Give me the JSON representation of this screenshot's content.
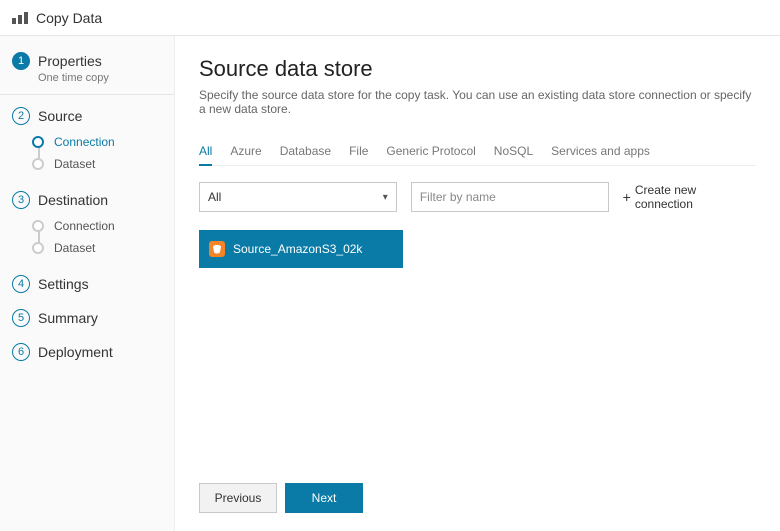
{
  "header": {
    "title": "Copy Data"
  },
  "sidebar": {
    "steps": [
      {
        "label": "Properties",
        "sub": "One time copy"
      },
      {
        "label": "Source"
      },
      {
        "label": "Destination"
      },
      {
        "label": "Settings"
      },
      {
        "label": "Summary"
      },
      {
        "label": "Deployment"
      }
    ],
    "source_substeps": [
      {
        "label": "Connection"
      },
      {
        "label": "Dataset"
      }
    ],
    "dest_substeps": [
      {
        "label": "Connection"
      },
      {
        "label": "Dataset"
      }
    ]
  },
  "main": {
    "title": "Source data store",
    "description": "Specify the source data store for the copy task. You can use an existing data store connection or specify a new data store.",
    "tabs": [
      "All",
      "Azure",
      "Database",
      "File",
      "Generic Protocol",
      "NoSQL",
      "Services and apps"
    ],
    "filter_select": "All",
    "filter_placeholder": "Filter by name",
    "create_label": "Create new connection",
    "card": {
      "name": "Source_AmazonS3_02k"
    }
  },
  "footer": {
    "previous": "Previous",
    "next": "Next"
  }
}
